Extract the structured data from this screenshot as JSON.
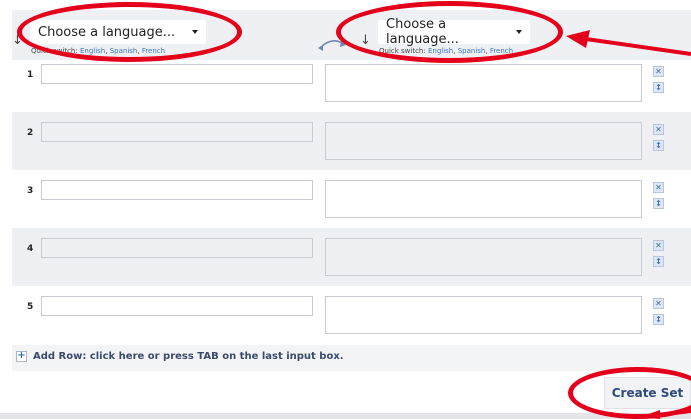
{
  "header": {
    "source_language": {
      "placeholder": "Choose a language...",
      "quick_switch_label": "Quick switch:",
      "quick_switch": [
        "English",
        "Spanish",
        "French"
      ]
    },
    "target_language": {
      "placeholder": "Choose a language...",
      "quick_switch_label": "Quick switch:",
      "quick_switch": [
        "English",
        "Spanish",
        "French"
      ]
    }
  },
  "rows": [
    {
      "number": "1",
      "term": "",
      "definition": ""
    },
    {
      "number": "2",
      "term": "",
      "definition": ""
    },
    {
      "number": "3",
      "term": "",
      "definition": ""
    },
    {
      "number": "4",
      "term": "",
      "definition": ""
    },
    {
      "number": "5",
      "term": "",
      "definition": ""
    }
  ],
  "row_icons": {
    "delete": "x-icon",
    "move": "move-icon"
  },
  "add_row": {
    "icon": "+",
    "label": "Add Row: click here or press TAB on the last input box."
  },
  "create_button": "Create Set",
  "colors": {
    "annotation": "#e4001b",
    "link": "#3b78c4",
    "alt_row_bg": "#eef0f3"
  }
}
